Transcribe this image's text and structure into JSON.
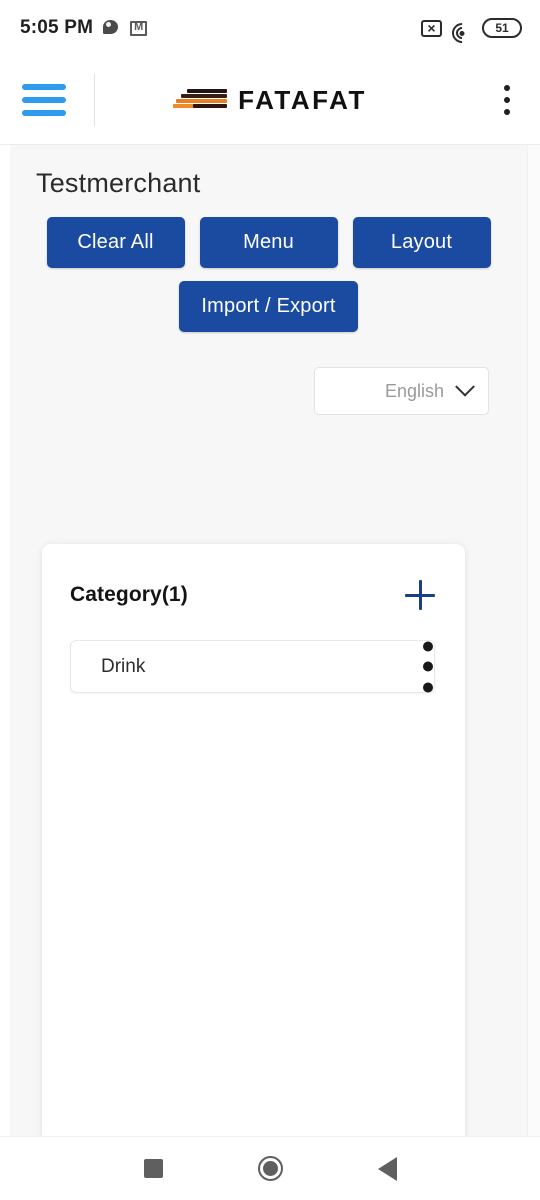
{
  "status_bar": {
    "time": "5:05 PM",
    "notification_icons": [
      "chat-bubble-icon",
      "gmail-icon"
    ],
    "no_sim_icon": "no-sim-icon",
    "wifi_icon": "wifi-icon",
    "battery_level": "51"
  },
  "app_bar": {
    "menu_icon": "hamburger-menu-icon",
    "brand_name": "FATAFAT",
    "logo_icon": "fatafat-logo-icon",
    "overflow_icon": "more-vertical-icon",
    "brand_color": "#1b4ba0",
    "menu_color": "#2e9bed"
  },
  "page": {
    "title": "Testmerchant",
    "actions": [
      {
        "label": "Clear All",
        "name": "clear-all-button"
      },
      {
        "label": "Menu",
        "name": "menu-button"
      },
      {
        "label": "Layout",
        "name": "layout-button"
      },
      {
        "label": "Import / Export",
        "name": "import-export-button"
      }
    ],
    "language": {
      "selected": "English",
      "chevron_icon": "chevron-down-icon"
    }
  },
  "category_card": {
    "title": "Category(1)",
    "add_icon": "plus-icon",
    "items": [
      {
        "label": "Drink",
        "menu_icon": "more-vertical-icon"
      }
    ]
  },
  "nav_bar": {
    "recents_icon": "square-recents-icon",
    "home_icon": "circle-home-icon",
    "back_icon": "triangle-back-icon"
  }
}
